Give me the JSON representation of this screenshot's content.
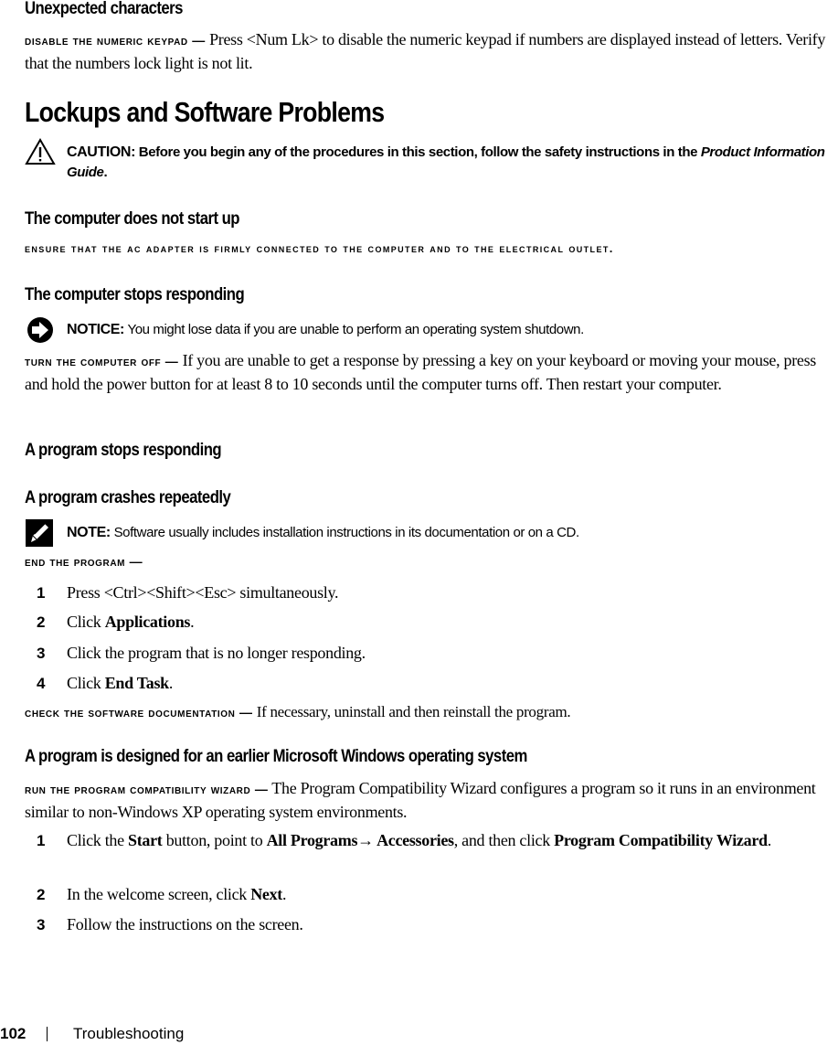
{
  "sections": {
    "unexpected": {
      "heading": "Unexpected characters",
      "lead": "Disable the numeric keypad —",
      "text": "Press <Num Lk> to disable the numeric keypad if numbers are displayed instead of letters. Verify that the numbers lock light is not lit."
    },
    "lockups": {
      "title": "Lockups and Software Problems",
      "caution": {
        "icon": "warning-triangle-icon",
        "label": "CAUTION:",
        "text": "Before you begin any of the procedures in this section, follow the safety instructions in the",
        "italic": "Product Information Guide",
        "end": "."
      }
    },
    "not_start": {
      "heading": "The computer does not start up",
      "lead": "Ensure that the AC adapter is firmly connected to the computer and to the electrical outlet."
    },
    "stops": {
      "heading": "The computer stops responding",
      "notice": {
        "icon": "notice-arrow-icon",
        "label": "NOTICE:",
        "text": "You might lose data if you are unable to perform an operating system shutdown."
      },
      "lead": "Turn the computer off —",
      "text": "If you are unable to get a response by pressing a key on your keyboard or moving your mouse, press and hold the power button for at least 8 to 10 seconds until the computer turns off. Then restart your computer."
    },
    "program_stops": {
      "heading": "A program stops responding"
    },
    "program_crashes": {
      "heading": "A program crashes repeatedly",
      "note": {
        "icon": "note-pencil-icon",
        "label": "NOTE:",
        "text": "Software usually includes installation instructions in its documentation or on a CD."
      },
      "lead": "End the program —",
      "steps": [
        {
          "num": "1",
          "pre": "Press <Ctrl><Shift><Esc> simultaneously.",
          "bold": "",
          "post": ""
        },
        {
          "num": "2",
          "pre": "Click ",
          "bold": "Applications",
          "post": "."
        },
        {
          "num": "3",
          "pre": "Click the program that is no longer responding.",
          "bold": "",
          "post": ""
        },
        {
          "num": "4",
          "pre": "Click ",
          "bold": "End Task",
          "post": "."
        }
      ],
      "check_lead": "Check the software documentation —",
      "check_text": "If necessary, uninstall and then reinstall the program."
    },
    "earlier_windows": {
      "heading": "A program is designed for an earlier Microsoft Windows operating system",
      "lead": "Run the Program Compatibility Wizard —",
      "text": "The Program Compatibility Wizard configures a program so it runs in an environment similar to non-Windows XP operating system environments.",
      "steps": {
        "s1": {
          "num": "1",
          "t1": "Click the ",
          "b1": "Start",
          "t2": " button, point to ",
          "b2": "All Programs",
          "arrow": "→",
          "b3": " Accessories",
          "t3": ", and then click ",
          "b4": "Program Compatibility Wizard",
          "t4": "."
        },
        "s2": {
          "num": "2",
          "t1": "In the welcome screen, click ",
          "b1": "Next",
          "t2": "."
        },
        "s3": {
          "num": "3",
          "t1": "Follow the instructions on the screen."
        }
      }
    }
  },
  "footer": {
    "page_number": "102",
    "separator": "|",
    "chapter": "Troubleshooting"
  }
}
